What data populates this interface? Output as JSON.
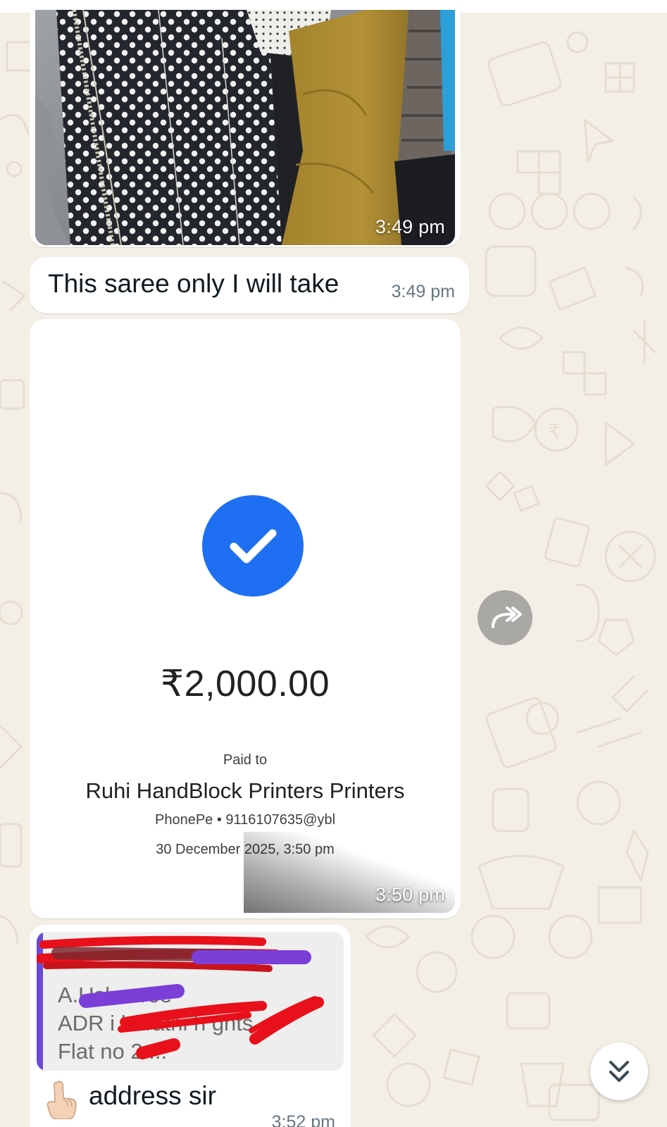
{
  "chat": {
    "messages": [
      {
        "type": "image",
        "description_icon": "saree-photo",
        "time": "3:49 pm"
      },
      {
        "type": "text",
        "text": "This saree only I will take",
        "time": "3:49 pm"
      },
      {
        "type": "image",
        "time": "3:50 pm",
        "payment": {
          "icon": "check-circle-icon",
          "amount": "₹2,000.00",
          "paid_to_label": "Paid to",
          "payee": "Ruhi HandBlock Printers Printers",
          "vpa": "PhonePe • 9116107635@ybl",
          "datetime": "30 December 2025, 3:50 pm"
        }
      },
      {
        "type": "reply",
        "quoted_lines": [
          "A.Ushasree",
          "ADR i   harathi h   ghts",
          "Flat no 2   ..."
        ],
        "emoji_icon": "pointing-hand-icon",
        "text": "address sir",
        "time": "3:52 pm"
      }
    ]
  },
  "buttons": {
    "forward_icon": "forward-icon",
    "scroll_down_icon": "double-chevron-down-icon"
  },
  "colors": {
    "wallpaper": "#f4efe6",
    "bubble": "#ffffff",
    "check_blue": "#1f6ff2",
    "quote_bar": "#6a4ad6",
    "redaction_red": "#e8101a",
    "redaction_purple": "#7b3fd8"
  }
}
